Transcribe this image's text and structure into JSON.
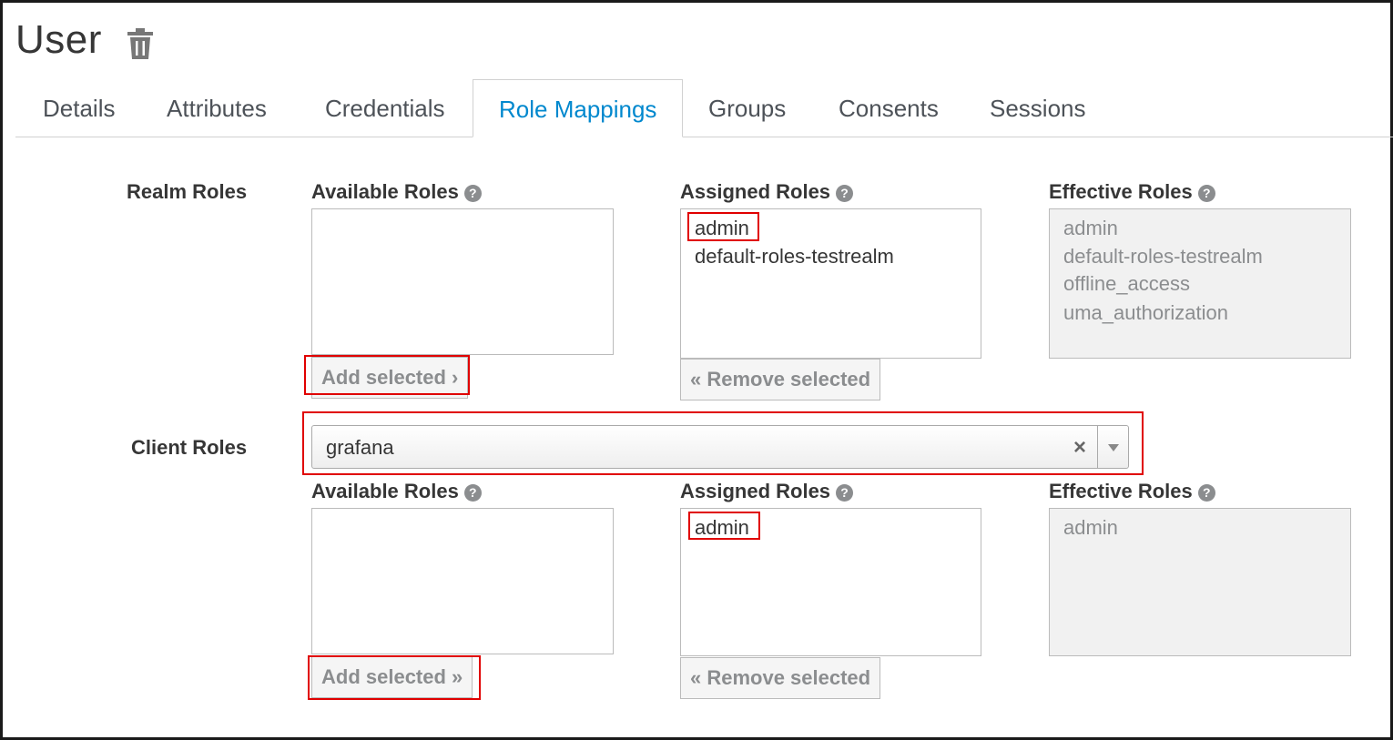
{
  "page": {
    "title": "User",
    "delete_icon": "trash-icon"
  },
  "tabs": [
    {
      "label": "Details",
      "active": false
    },
    {
      "label": "Attributes",
      "active": false
    },
    {
      "label": "Credentials",
      "active": false
    },
    {
      "label": "Role Mappings",
      "active": true
    },
    {
      "label": "Groups",
      "active": false
    },
    {
      "label": "Consents",
      "active": false
    },
    {
      "label": "Sessions",
      "active": false
    }
  ],
  "realm_roles": {
    "label": "Realm Roles",
    "available": {
      "header": "Available Roles",
      "items": []
    },
    "assigned": {
      "header": "Assigned Roles",
      "items": [
        "admin",
        "default-roles-testrealm"
      ]
    },
    "effective": {
      "header": "Effective Roles",
      "items": [
        "admin",
        "default-roles-testrealm",
        "offline_access",
        "uma_authorization"
      ]
    },
    "add_button": "Add selected ›",
    "remove_button": "« Remove selected"
  },
  "client_roles": {
    "label": "Client Roles",
    "client_select": {
      "value": "grafana",
      "clear_glyph": "×"
    },
    "available": {
      "header": "Available Roles",
      "items": []
    },
    "assigned": {
      "header": "Assigned Roles",
      "items": [
        "admin"
      ]
    },
    "effective": {
      "header": "Effective Roles",
      "items": [
        "admin"
      ]
    },
    "add_button": "Add selected »",
    "remove_button": "« Remove selected"
  },
  "help_glyph": "?",
  "colors": {
    "accent": "#0088ce",
    "highlight": "#e00000",
    "readonly_bg": "#f1f1f1"
  }
}
